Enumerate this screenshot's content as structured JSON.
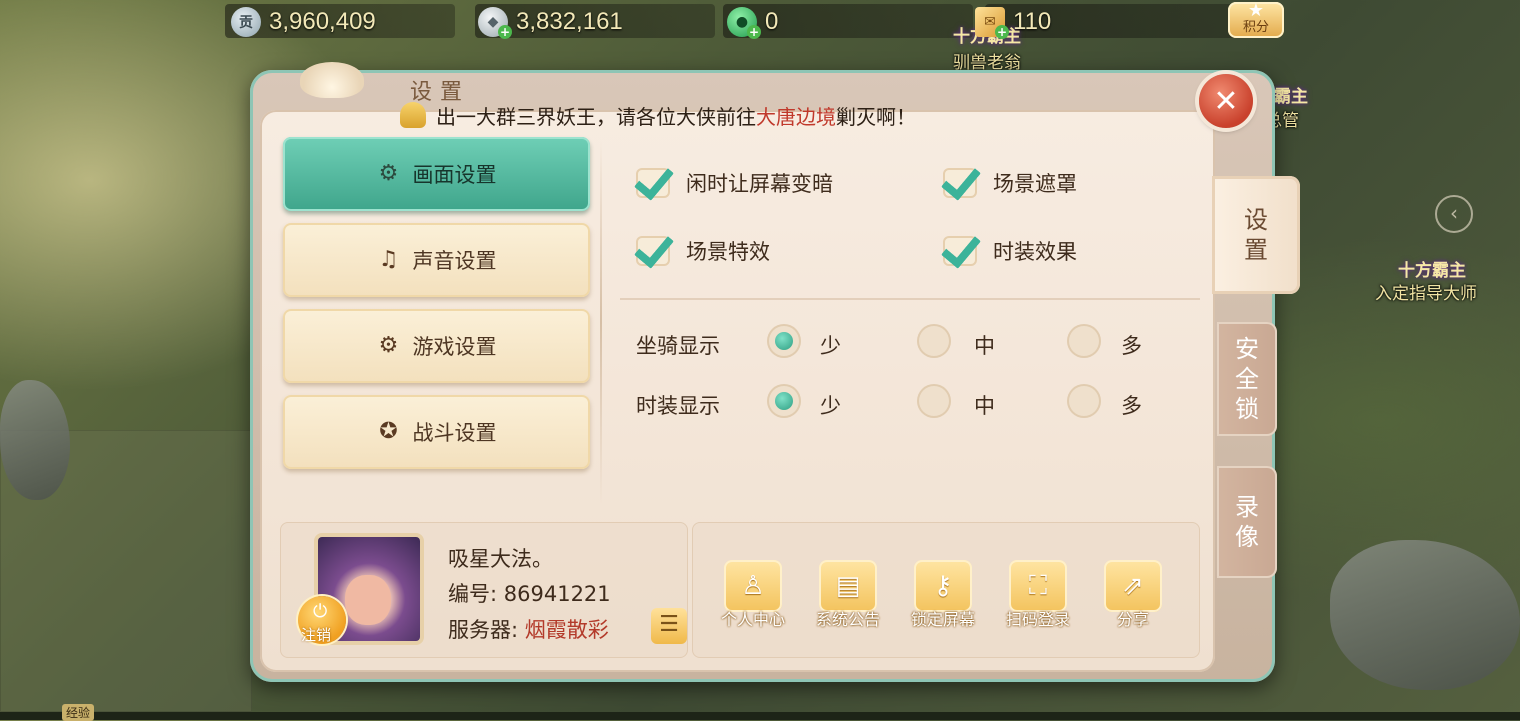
{
  "currencies": [
    {
      "icon": "tribute-coin-icon",
      "value": "3,960,409"
    },
    {
      "icon": "silver-ingot-icon",
      "value": "3,832,161"
    },
    {
      "icon": "jade-icon",
      "value": "0"
    },
    {
      "icon": "scroll-ticket-icon",
      "value": "110"
    }
  ],
  "points_label": "积分",
  "npcs": [
    {
      "title": "十方霸主",
      "name": "驯兽老翁"
    },
    {
      "title": "十方霸主",
      "name": "戏总管"
    },
    {
      "title": "十方霸主",
      "name": "入定指导大师"
    }
  ],
  "panel": {
    "title": "设置",
    "close_icon": "close-icon"
  },
  "announcement": {
    "prefix": "出一大群三界妖王，请各位大侠前往",
    "highlight": "大唐边境",
    "suffix": "剿灭啊！"
  },
  "menu": [
    {
      "label": "画面设置",
      "icon": "gears-icon",
      "active": true
    },
    {
      "label": "声音设置",
      "icon": "music-note-icon",
      "active": false
    },
    {
      "label": "游戏设置",
      "icon": "gears-icon",
      "active": false
    },
    {
      "label": "战斗设置",
      "icon": "gear-sword-icon",
      "active": false
    }
  ],
  "checkboxes": [
    {
      "label": "闲时让屏幕变暗",
      "checked": true
    },
    {
      "label": "场景遮罩",
      "checked": true
    },
    {
      "label": "场景特效",
      "checked": true
    },
    {
      "label": "时装效果",
      "checked": true
    }
  ],
  "radio_groups": [
    {
      "label": "坐骑显示",
      "options": [
        "少",
        "中",
        "多"
      ],
      "selected": "少"
    },
    {
      "label": "时装显示",
      "options": [
        "少",
        "中",
        "多"
      ],
      "selected": "少"
    }
  ],
  "profile": {
    "name": "吸星大法。",
    "id_label": "编号:",
    "id_value": "86941221",
    "server_label": "服务器:",
    "server_value": "烟霞散彩",
    "logout_label": "注销"
  },
  "actions": [
    {
      "label": "个人中心",
      "icon": "person-icon"
    },
    {
      "label": "系统公告",
      "icon": "scroll-icon"
    },
    {
      "label": "锁定屏幕",
      "icon": "key-icon"
    },
    {
      "label": "扫码登录",
      "icon": "qr-scan-icon"
    },
    {
      "label": "分享",
      "icon": "share-icon"
    }
  ],
  "side_tabs": [
    {
      "label": "设\n置",
      "active": true
    },
    {
      "label": "安\n全\n锁",
      "active": false
    },
    {
      "label": "录\n像",
      "active": false
    }
  ],
  "exp_label": "经验"
}
